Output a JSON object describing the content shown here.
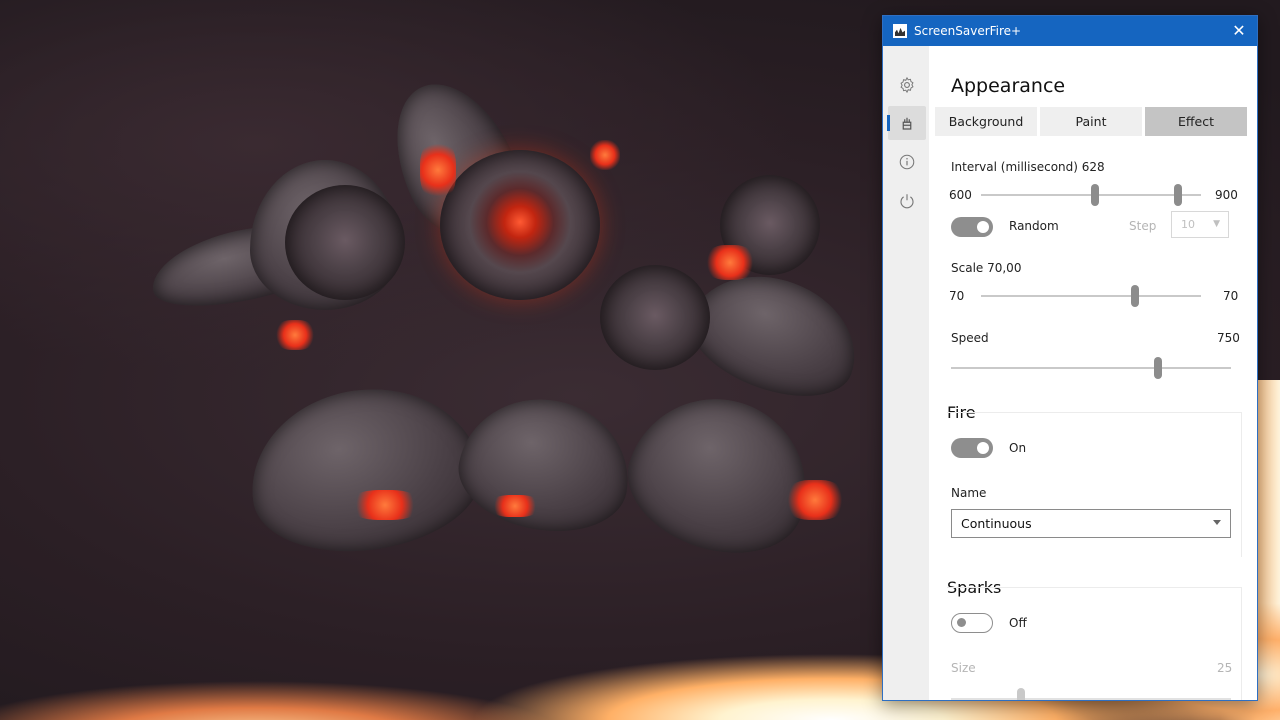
{
  "window": {
    "title": "ScreenSaverFire+"
  },
  "icons": {
    "settings": "gear-icon",
    "appearance": "paint-bucket-icon",
    "info": "info-icon",
    "power": "power-icon",
    "close": "close-icon"
  },
  "accent_color": "#1565c0",
  "appearance": {
    "title": "Appearance",
    "tabs": [
      "Background",
      "Paint",
      "Effect"
    ],
    "selected_tab": "Effect"
  },
  "interval": {
    "label": "Interval (millisecond) 628",
    "min_label": "600",
    "max_label": "900",
    "range": [
      600,
      900
    ],
    "values": [
      756,
      868
    ],
    "random_label": "Random",
    "random_on": true,
    "step_label": "Step",
    "step_value": "10"
  },
  "scale": {
    "label": "Scale 70,00",
    "min_label": "70",
    "max_label": "70",
    "fraction": 0.7
  },
  "speed": {
    "label": "Speed",
    "value_label": "750",
    "fraction": 0.74
  },
  "fire": {
    "title": "Fire",
    "toggle_label": "On",
    "on": true,
    "name_label": "Name",
    "name_value": "Continuous"
  },
  "sparks": {
    "title": "Sparks",
    "toggle_label": "Off",
    "on": false,
    "size_label": "Size",
    "size_value": "25",
    "size_fraction": 0.25
  }
}
